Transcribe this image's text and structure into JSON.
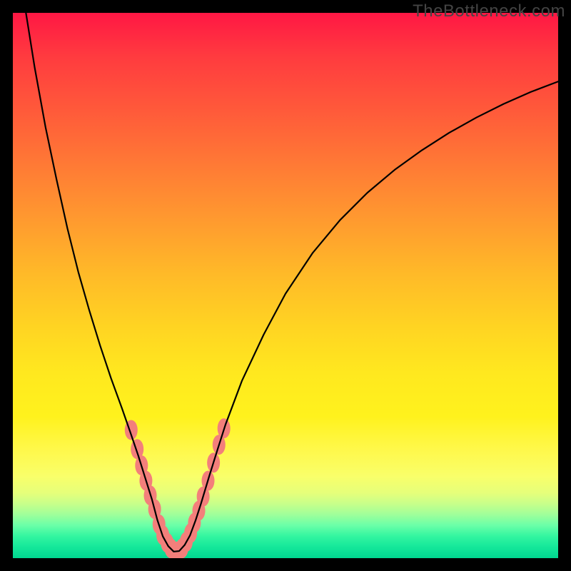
{
  "watermark": "TheBottleneck.com",
  "chart_data": {
    "type": "line",
    "title": "",
    "xlabel": "",
    "ylabel": "",
    "xlim": [
      0,
      100
    ],
    "ylim": [
      0,
      100
    ],
    "grid": false,
    "series": [
      {
        "name": "curve",
        "marker": false,
        "color": "#000000",
        "points": [
          {
            "x": 2.4,
            "y": 100.0
          },
          {
            "x": 4.0,
            "y": 90.0
          },
          {
            "x": 6.0,
            "y": 79.0
          },
          {
            "x": 8.0,
            "y": 69.5
          },
          {
            "x": 10.0,
            "y": 60.5
          },
          {
            "x": 12.0,
            "y": 52.5
          },
          {
            "x": 14.0,
            "y": 45.5
          },
          {
            "x": 16.0,
            "y": 39.0
          },
          {
            "x": 18.0,
            "y": 33.0
          },
          {
            "x": 20.0,
            "y": 27.5
          },
          {
            "x": 21.5,
            "y": 23.2
          },
          {
            "x": 23.0,
            "y": 18.8
          },
          {
            "x": 24.5,
            "y": 14.0
          },
          {
            "x": 25.5,
            "y": 10.8
          },
          {
            "x": 26.5,
            "y": 7.0
          },
          {
            "x": 27.5,
            "y": 4.0
          },
          {
            "x": 28.5,
            "y": 2.2
          },
          {
            "x": 29.5,
            "y": 1.2
          },
          {
            "x": 30.5,
            "y": 1.3
          },
          {
            "x": 31.5,
            "y": 2.4
          },
          {
            "x": 32.5,
            "y": 4.2
          },
          {
            "x": 33.5,
            "y": 6.9
          },
          {
            "x": 34.5,
            "y": 10.0
          },
          {
            "x": 36.0,
            "y": 15.0
          },
          {
            "x": 37.5,
            "y": 19.8
          },
          {
            "x": 39.0,
            "y": 24.5
          },
          {
            "x": 42.0,
            "y": 32.5
          },
          {
            "x": 46.0,
            "y": 41.0
          },
          {
            "x": 50.0,
            "y": 48.5
          },
          {
            "x": 55.0,
            "y": 56.0
          },
          {
            "x": 60.0,
            "y": 62.0
          },
          {
            "x": 65.0,
            "y": 67.0
          },
          {
            "x": 70.0,
            "y": 71.2
          },
          {
            "x": 75.0,
            "y": 74.8
          },
          {
            "x": 80.0,
            "y": 78.0
          },
          {
            "x": 85.0,
            "y": 80.8
          },
          {
            "x": 90.0,
            "y": 83.3
          },
          {
            "x": 95.0,
            "y": 85.5
          },
          {
            "x": 100.0,
            "y": 87.4
          }
        ]
      },
      {
        "name": "blobs",
        "marker": true,
        "color": "#f37f7b",
        "points": [
          {
            "x": 21.7,
            "y": 23.5
          },
          {
            "x": 22.8,
            "y": 20.0
          },
          {
            "x": 23.6,
            "y": 17.0
          },
          {
            "x": 24.4,
            "y": 14.2
          },
          {
            "x": 25.2,
            "y": 11.5
          },
          {
            "x": 26.0,
            "y": 9.0
          },
          {
            "x": 26.8,
            "y": 6.2
          },
          {
            "x": 27.5,
            "y": 4.2
          },
          {
            "x": 28.3,
            "y": 2.8
          },
          {
            "x": 29.0,
            "y": 1.8
          },
          {
            "x": 30.0,
            "y": 1.2
          },
          {
            "x": 31.0,
            "y": 1.8
          },
          {
            "x": 31.8,
            "y": 3.0
          },
          {
            "x": 32.6,
            "y": 4.6
          },
          {
            "x": 33.3,
            "y": 6.5
          },
          {
            "x": 34.1,
            "y": 8.7
          },
          {
            "x": 34.9,
            "y": 11.3
          },
          {
            "x": 35.8,
            "y": 14.2
          },
          {
            "x": 36.8,
            "y": 17.5
          },
          {
            "x": 37.8,
            "y": 20.8
          },
          {
            "x": 38.7,
            "y": 23.8
          }
        ]
      }
    ]
  }
}
